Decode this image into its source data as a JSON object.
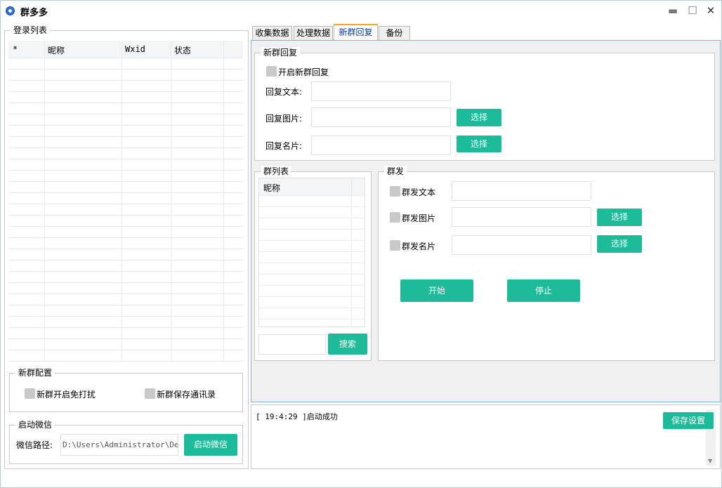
{
  "window": {
    "title": "群多多",
    "minimize": "▬",
    "maximize": "☐",
    "close": "✕"
  },
  "login_list": {
    "legend": "登录列表",
    "columns": [
      "*",
      "昵称",
      "Wxid",
      "状态"
    ]
  },
  "new_group_config": {
    "legend": "新群配置",
    "no_disturb_label": "新群开启免打扰",
    "save_contacts_label": "新群保存通讯录"
  },
  "launch_wechat": {
    "legend": "启动微信",
    "path_label": "微信路径:",
    "path_value": "D:\\Users\\Administrator\\Deskt",
    "launch_button": "启动微信"
  },
  "tabs": [
    "收集数据",
    "处理数据",
    "新群回复",
    "备份"
  ],
  "new_group_reply": {
    "legend": "新群回复",
    "enable_label": "开启新群回复",
    "reply_text_label": "回复文本:",
    "reply_image_label": "回复图片:",
    "reply_card_label": "回复名片:",
    "select_button": "选择"
  },
  "group_list": {
    "legend": "群列表",
    "column": "昵称",
    "search_button": "搜索"
  },
  "mass_send": {
    "legend": "群发",
    "text_label": "群发文本",
    "image_label": "群发图片",
    "card_label": "群发名片",
    "select_button": "选择",
    "start_button": "开始",
    "stop_button": "停止"
  },
  "log": {
    "line": "[ 19:4:29 ]启动成功",
    "save_button": "保存设置",
    "scroll_down": "▼"
  }
}
